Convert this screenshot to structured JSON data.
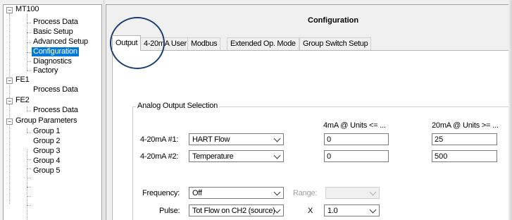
{
  "tree": {
    "items": [
      {
        "label": "MT100",
        "expander": "−"
      },
      {
        "label": "Process Data"
      },
      {
        "label": "Basic Setup"
      },
      {
        "label": "Advanced Setup"
      },
      {
        "label": "Configuration",
        "selected": true
      },
      {
        "label": "Diagnostics"
      },
      {
        "label": "Factory"
      },
      {
        "label": "FE1",
        "expander": "−"
      },
      {
        "label": "Process Data"
      },
      {
        "label": "FE2",
        "expander": "−"
      },
      {
        "label": "Process Data"
      },
      {
        "label": "Group Parameters",
        "expander": "−"
      },
      {
        "label": "Group 1"
      },
      {
        "label": "Group 2"
      },
      {
        "label": "Group 3"
      },
      {
        "label": "Group 4"
      },
      {
        "label": "Group 5"
      }
    ]
  },
  "panel": {
    "title": "Configuration",
    "tabs": [
      {
        "label": "Output",
        "active": true
      },
      {
        "label": "4-20mA User"
      },
      {
        "label": "Modbus"
      },
      {
        "label": "Extended Op. Mode"
      },
      {
        "label": "Group Switch Setup"
      }
    ]
  },
  "analog": {
    "legend": "Analog Output Selection",
    "col1_header": "4mA @ Units <= ...",
    "col2_header": "20mA @ Units >= ...",
    "row1": {
      "label": "4-20mA #1:",
      "select": "HART Flow",
      "low": "0",
      "high": "25"
    },
    "row2": {
      "label": "4-20mA #2:",
      "select": "Temperature",
      "low": "0",
      "high": "500"
    },
    "frequency": {
      "label": "Frequency:",
      "select": "Off",
      "range_label": "Range:",
      "range_value": ""
    },
    "pulse": {
      "label": "Pulse:",
      "select": "Tot Flow on CH2 (source)",
      "x_label": "X",
      "multiplier": "1.0"
    }
  },
  "colors": {
    "selection": "#0078d7",
    "circle": "#1d3e6e"
  }
}
